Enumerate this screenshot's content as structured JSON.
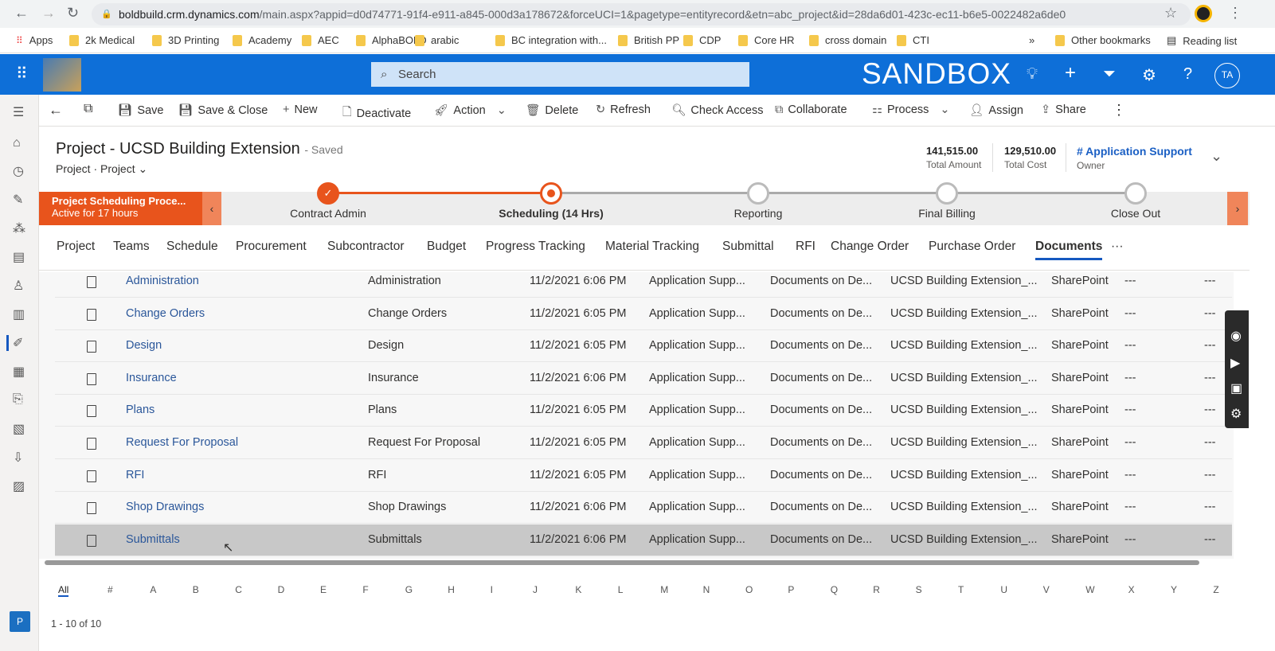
{
  "browser": {
    "url_domain": "boldbuild.crm.dynamics.com",
    "url_path": "/main.aspx?appid=d0d74771-91f4-e911-a845-000d3a178672&forceUCI=1&pagetype=entityrecord&etn=abc_project&id=28da6d01-423c-ec11-b6e5-0022482a6de0",
    "bookmarks": [
      "Apps",
      "2k Medical",
      "3D Printing",
      "Academy",
      "AEC",
      "AlphaBOLD",
      "arabic",
      "BC integration with...",
      "British PP",
      "CDP",
      "Core HR",
      "cross domain",
      "CTI"
    ],
    "other_bookmarks": "Other bookmarks",
    "reading_list": "Reading list",
    "more": "»"
  },
  "appbar": {
    "search_placeholder": "Search",
    "env_label": "SANDBOX",
    "avatar": "TA"
  },
  "commands": [
    "Save",
    "Save & Close",
    "New",
    "Deactivate",
    "Action",
    "Delete",
    "Refresh",
    "Check Access",
    "Collaborate",
    "Process",
    "Assign",
    "Share"
  ],
  "header": {
    "title": "Project - UCSD Building Extension",
    "saved": "- Saved",
    "entity": "Project",
    "form": "Project",
    "total_amount": "141,515.00",
    "total_amount_label": "Total Amount",
    "total_cost": "129,510.00",
    "total_cost_label": "Total Cost",
    "owner": "# Application Support",
    "owner_label": "Owner"
  },
  "bpf": {
    "name": "Project Scheduling Proce...",
    "active": "Active for 17 hours",
    "stages": [
      {
        "label": "Contract Admin",
        "state": "completed"
      },
      {
        "label": "Scheduling  (14 Hrs)",
        "state": "active"
      },
      {
        "label": "Reporting",
        "state": "pending"
      },
      {
        "label": "Final Billing",
        "state": "pending"
      },
      {
        "label": "Close Out",
        "state": "pending"
      }
    ],
    "accent": "#e8541c"
  },
  "tabs": [
    "Project",
    "Teams",
    "Schedule",
    "Procurement",
    "Subcontractor",
    "Budget",
    "Progress Tracking",
    "Material Tracking",
    "Submittal",
    "RFI",
    "Change Order",
    "Purchase Order",
    "Documents",
    "···"
  ],
  "active_tab": "Documents",
  "rows": [
    [
      "Administration",
      "Administration",
      "11/2/2021 6:06 PM",
      "Application Supp...",
      "Documents on De...",
      "UCSD Building Extension_...",
      "SharePoint",
      "---",
      "---"
    ],
    [
      "Change Orders",
      "Change Orders",
      "11/2/2021 6:05 PM",
      "Application Supp...",
      "Documents on De...",
      "UCSD Building Extension_...",
      "SharePoint",
      "---",
      "---"
    ],
    [
      "Design",
      "Design",
      "11/2/2021 6:05 PM",
      "Application Supp...",
      "Documents on De...",
      "UCSD Building Extension_...",
      "SharePoint",
      "---",
      "---"
    ],
    [
      "Insurance",
      "Insurance",
      "11/2/2021 6:06 PM",
      "Application Supp...",
      "Documents on De...",
      "UCSD Building Extension_...",
      "SharePoint",
      "---",
      "---"
    ],
    [
      "Plans",
      "Plans",
      "11/2/2021 6:05 PM",
      "Application Supp...",
      "Documents on De...",
      "UCSD Building Extension_...",
      "SharePoint",
      "---",
      "---"
    ],
    [
      "Request For Proposal",
      "Request For Proposal",
      "11/2/2021 6:05 PM",
      "Application Supp...",
      "Documents on De...",
      "UCSD Building Extension_...",
      "SharePoint",
      "---",
      "---"
    ],
    [
      "RFI",
      "RFI",
      "11/2/2021 6:05 PM",
      "Application Supp...",
      "Documents on De...",
      "UCSD Building Extension_...",
      "SharePoint",
      "---",
      "---"
    ],
    [
      "Shop Drawings",
      "Shop Drawings",
      "11/2/2021 6:06 PM",
      "Application Supp...",
      "Documents on De...",
      "UCSD Building Extension_...",
      "SharePoint",
      "---",
      "---"
    ],
    [
      "Submittals",
      "Submittals",
      "11/2/2021 6:06 PM",
      "Application Supp...",
      "Documents on De...",
      "UCSD Building Extension_...",
      "SharePoint",
      "---",
      "---"
    ]
  ],
  "jump": [
    "All",
    "#",
    "A",
    "B",
    "C",
    "D",
    "E",
    "F",
    "G",
    "H",
    "I",
    "J",
    "K",
    "L",
    "M",
    "N",
    "O",
    "P",
    "Q",
    "R",
    "S",
    "T",
    "U",
    "V",
    "W",
    "X",
    "Y",
    "Z"
  ],
  "footer": {
    "count": "1 - 10 of 10",
    "tile": "P"
  }
}
